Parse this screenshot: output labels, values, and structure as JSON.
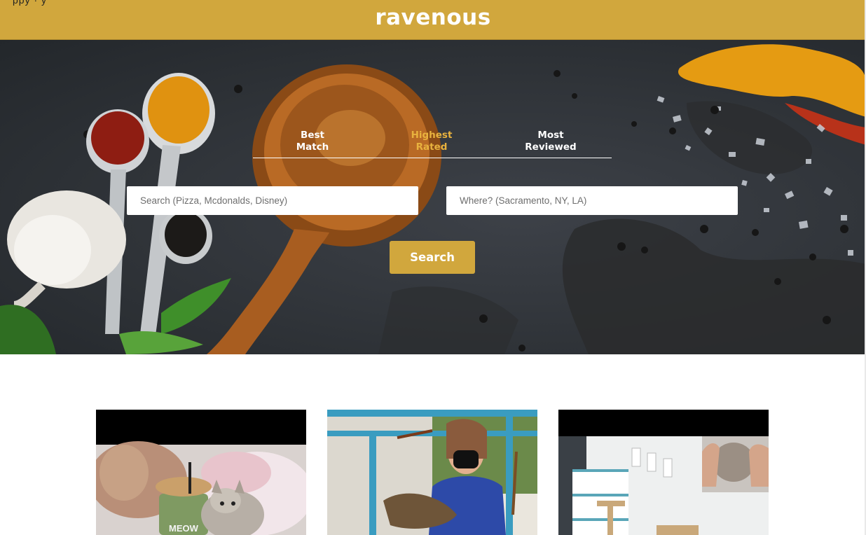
{
  "app": {
    "corner_text": "ppy · y",
    "brand": "ravenous"
  },
  "sort_options": [
    {
      "label_line1": "Best",
      "label_line2": "Match",
      "active": false
    },
    {
      "label_line1": "Highest",
      "label_line2": "Rated",
      "active": true
    },
    {
      "label_line1": "Most",
      "label_line2": "Reviewed",
      "active": false
    }
  ],
  "search": {
    "term_placeholder": "Search (Pizza, Mcdonalds, Disney)",
    "location_placeholder": "Where? (Sacramento, NY, LA)",
    "button_label": "Search"
  },
  "cards": {
    "card1_cup_text": "MEOW"
  },
  "colors": {
    "brand": "#d1a73d",
    "active_tab": "#e8b23e",
    "hero_slate": "#2f3338"
  }
}
